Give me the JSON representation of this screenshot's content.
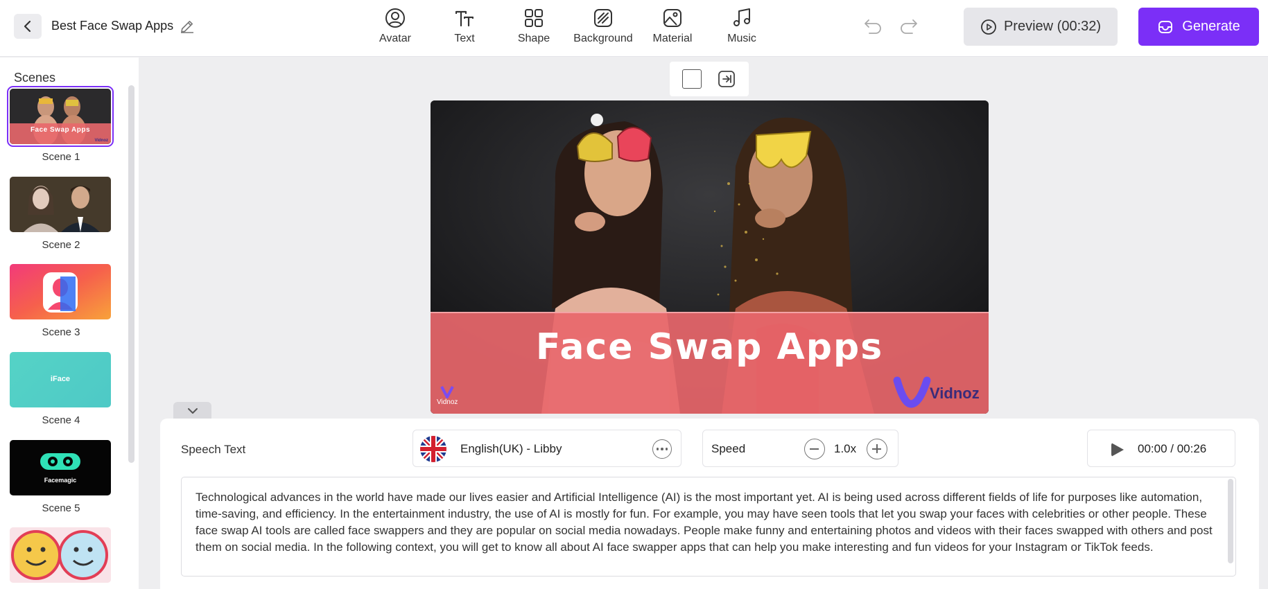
{
  "header": {
    "project_title": "Best Face Swap Apps",
    "tools": [
      {
        "label": "Avatar",
        "icon": "avatar-icon"
      },
      {
        "label": "Text",
        "icon": "text-icon"
      },
      {
        "label": "Shape",
        "icon": "shape-icon"
      },
      {
        "label": "Background",
        "icon": "background-icon"
      },
      {
        "label": "Material",
        "icon": "material-icon"
      },
      {
        "label": "Music",
        "icon": "music-icon"
      }
    ],
    "preview_label": "Preview (00:32)",
    "generate_label": "Generate"
  },
  "sidebar": {
    "title": "Scenes",
    "scenes": [
      {
        "label": "Scene 1",
        "thumb_text": "Face Swap Apps",
        "thumb_logo": "Vidnoz"
      },
      {
        "label": "Scene 2"
      },
      {
        "label": "Scene 3"
      },
      {
        "label": "Scene 4",
        "thumb_text": "iFace"
      },
      {
        "label": "Scene 5",
        "thumb_text": "Facemagic"
      }
    ]
  },
  "canvas": {
    "headline": "Face Swap Apps",
    "watermark_small": "Vidnoz",
    "watermark_logo": "Vidnoz"
  },
  "bottom_panel": {
    "speech_label": "Speech Text",
    "voice": "English(UK) - Libby",
    "speed_label": "Speed",
    "speed_value": "1.0x",
    "time": "00:00 / 00:26",
    "speech_text": "Technological advances in the world have made our lives easier and Artificial Intelligence (AI) is the most important yet. AI is being used across different fields of life for purposes like automation, time-saving, and efficiency. In the entertainment industry, the use of AI is mostly for fun. For example, you may have seen tools that let you swap your faces with celebrities or other people. These face swap AI tools are called face swappers and they are popular on social media nowadays. People make funny and entertaining photos and videos with their faces swapped with others and post them on social media. In the following context, you will get to know all about AI face swapper apps that can help you make interesting and fun videos for your Instagram or TikTok feeds."
  },
  "colors": {
    "accent": "#7b2ff7",
    "banner": "#e8676b"
  }
}
